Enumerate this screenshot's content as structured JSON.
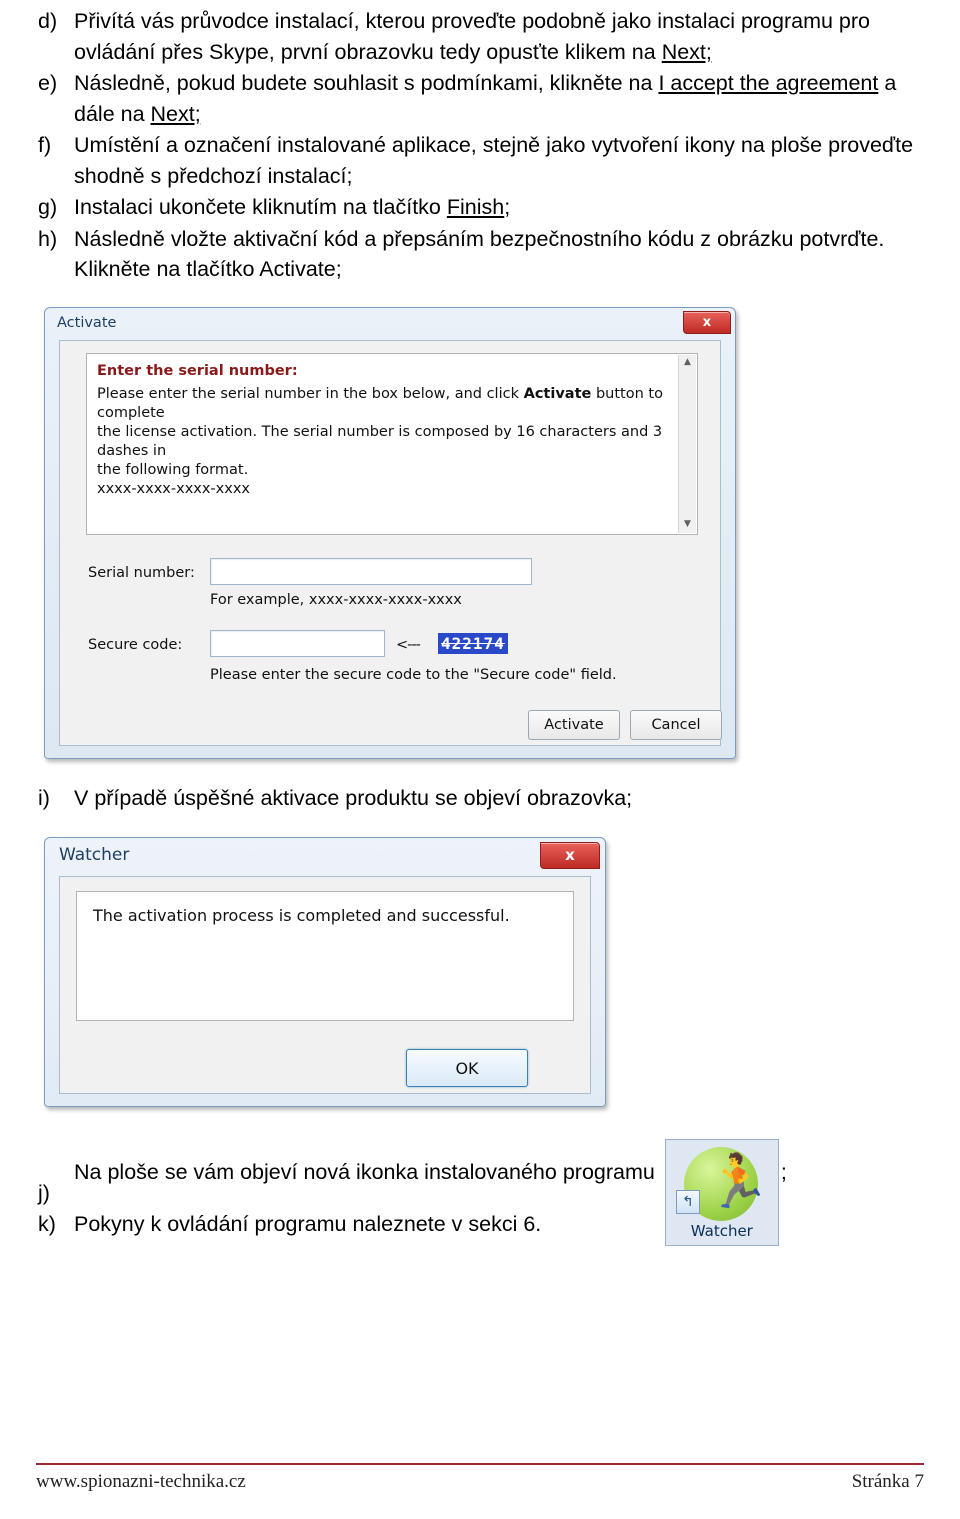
{
  "instructions": [
    {
      "marker": "d)",
      "segments": [
        {
          "t": "Přivítá vás průvodce instalací, kterou proveďte podobně jako instalaci programu pro ovládání přes Skype, první obrazovku tedy opusťte klikem na ",
          "u": false
        },
        {
          "t": "Next;",
          "u": true
        }
      ]
    },
    {
      "marker": "e)",
      "segments": [
        {
          "t": "Následně, pokud budete souhlasit s podmínkami, klikněte na ",
          "u": false
        },
        {
          "t": "I accept the agreement",
          "u": true
        },
        {
          "t": " a dále na ",
          "u": false
        },
        {
          "t": "Next;",
          "u": true
        }
      ]
    },
    {
      "marker": "f)",
      "segments": [
        {
          "t": "Umístění a označení instalované aplikace, stejně jako vytvoření ikony na ploše proveďte shodně s předchozí instalací;",
          "u": false
        }
      ]
    },
    {
      "marker": "g)",
      "segments": [
        {
          "t": "Instalaci ukončete kliknutím na tlačítko ",
          "u": false
        },
        {
          "t": "Finish",
          "u": true
        },
        {
          "t": ";",
          "u": false
        }
      ]
    },
    {
      "marker": "h)",
      "segments": [
        {
          "t": "Následně vložte aktivační kód a přepsáním bezpečnostního kódu z obrázku potvrďte. Klikněte na tlačítko Activate;",
          "u": false
        }
      ]
    }
  ],
  "activate_dialog": {
    "title": "Activate",
    "close_label": "x",
    "info_heading": "Enter the serial number:",
    "info_line1_a": "Please enter the serial number in the box below, and click ",
    "info_line1_b": "Activate",
    "info_line1_c": " button to complete",
    "info_line2": "the license activation. The serial number is composed by 16 characters and 3 dashes in",
    "info_line3": "the following format.",
    "info_format": "xxxx-xxxx-xxxx-xxxx",
    "serial_label": "Serial number:",
    "serial_value": "",
    "serial_example": "For example, xxxx-xxxx-xxxx-xxxx",
    "secure_label": "Secure code:",
    "secure_value": "",
    "arrow": "<---",
    "captcha_text": "422174",
    "secure_hint": "Please enter the secure code to the \"Secure code\" field.",
    "activate_button": "Activate",
    "cancel_button": "Cancel",
    "scroll_up": "▲",
    "scroll_down": "▼"
  },
  "caption_i": {
    "marker": "i)",
    "text": "V případě úspěšné aktivace produktu se objeví obrazovka;"
  },
  "watcher_dialog": {
    "title": "Watcher",
    "close_label": "x",
    "message": "The activation process is completed and successful.",
    "ok_button": "OK"
  },
  "tail": [
    {
      "marker": "j)",
      "text_before": "Na ploše se vám objeví nová ikonka instalovaného programu ",
      "text_after": ";"
    },
    {
      "marker": "k)",
      "text_before": "Pokyny k ovládání programu naleznete v sekci 6.",
      "text_after": ""
    }
  ],
  "desktop_icon": {
    "label": "Watcher",
    "glyph": "🏃",
    "shortcut_glyph": "↰"
  },
  "footer": {
    "left": "www.spionazni-technika.cz",
    "right": "Stránka 7"
  }
}
